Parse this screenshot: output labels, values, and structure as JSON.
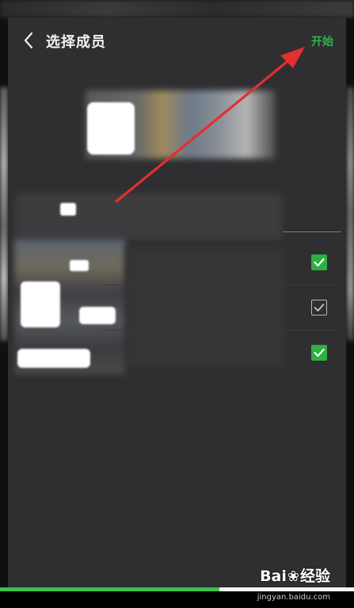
{
  "header": {
    "title": "选择成员",
    "start_label": "开始"
  },
  "members": [
    {
      "checked": true
    },
    {
      "checked": false
    },
    {
      "checked": true
    }
  ],
  "progress": {
    "fraction": 0.62
  },
  "watermark": {
    "logo_left": "Bai",
    "logo_right": "经验",
    "url": "jingyan.baidu.com"
  },
  "colors": {
    "accent_green": "#2fb44a",
    "arrow_red": "#e2302f",
    "background": "#2f2f31"
  },
  "icons": {
    "back": "chevron-left-icon",
    "check": "checkmark-icon",
    "watermark": "paw-icon"
  }
}
